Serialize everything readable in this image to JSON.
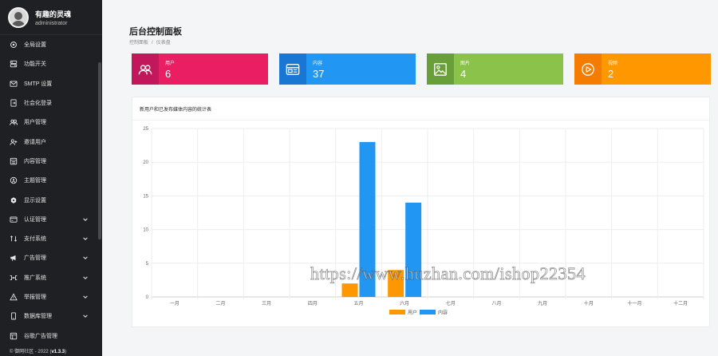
{
  "sidebar": {
    "app_name": "有趣的灵魂",
    "user_role": "administrator",
    "items": [
      {
        "label": "全局设置",
        "icon": "gear-icon",
        "has_children": false
      },
      {
        "label": "功能开关",
        "icon": "toggle-icon",
        "has_children": false
      },
      {
        "label": "SMTP 设置",
        "icon": "mail-icon",
        "has_children": false
      },
      {
        "label": "社会化登录",
        "icon": "login-icon",
        "has_children": false
      },
      {
        "label": "用户管理",
        "icon": "users-icon",
        "has_children": false
      },
      {
        "label": "邀请用户",
        "icon": "user-plus-icon",
        "has_children": false
      },
      {
        "label": "内容管理",
        "icon": "content-icon",
        "has_children": false
      },
      {
        "label": "主题管理",
        "icon": "theme-icon",
        "has_children": false
      },
      {
        "label": "显示设置",
        "icon": "display-icon",
        "has_children": false
      },
      {
        "label": "认证管理",
        "icon": "certificate-icon",
        "has_children": true
      },
      {
        "label": "支付系统",
        "icon": "payment-icon",
        "has_children": true
      },
      {
        "label": "广告管理",
        "icon": "megaphone-icon",
        "has_children": true
      },
      {
        "label": "推广系统",
        "icon": "promotion-icon",
        "has_children": true
      },
      {
        "label": "举报管理",
        "icon": "warning-icon",
        "has_children": true
      },
      {
        "label": "数据库管理",
        "icon": "database-icon",
        "has_children": true
      },
      {
        "label": "谷歌广告管理",
        "icon": "google-ads-icon",
        "has_children": false
      }
    ],
    "footer_prefix": "© 御网社区 - 2022",
    "footer_version": "v1.3.3"
  },
  "header": {
    "title": "后台控制面板",
    "breadcrumb": [
      "控制面板",
      "仪表盘"
    ]
  },
  "cards": [
    {
      "label": "用户",
      "value": "6",
      "color": "#e91e63",
      "icon_bg": "#c2185b",
      "icon": "users-icon"
    },
    {
      "label": "内容",
      "value": "37",
      "color": "#2196f3",
      "icon_bg": "#1976d2",
      "icon": "content-card-icon"
    },
    {
      "label": "图片",
      "value": "4",
      "color": "#8bc34a",
      "icon_bg": "#689f38",
      "icon": "image-icon"
    },
    {
      "label": "视频",
      "value": "2",
      "color": "#ff9800",
      "icon_bg": "#f57c00",
      "icon": "play-icon"
    }
  ],
  "chart_data": {
    "type": "bar",
    "title": "新用户和已发布媒体内容的统计表",
    "categories": [
      "一月",
      "二月",
      "三月",
      "四月",
      "五月",
      "六月",
      "七月",
      "八月",
      "九月",
      "十月",
      "十一月",
      "十二月"
    ],
    "series": [
      {
        "name": "用户",
        "color": "#ff9800",
        "values": [
          0,
          0,
          0,
          0,
          2,
          4,
          0,
          0,
          0,
          0,
          0,
          0
        ]
      },
      {
        "name": "内容",
        "color": "#2196f3",
        "values": [
          0,
          0,
          0,
          0,
          23,
          14,
          0,
          0,
          0,
          0,
          0,
          0
        ]
      }
    ],
    "ylim": [
      0,
      25
    ],
    "yticks": [
      0,
      5,
      10,
      15,
      20,
      25
    ],
    "grid": true,
    "legend": "bottom-center"
  },
  "watermark": "https://www.huzhan.com/ishop22354"
}
